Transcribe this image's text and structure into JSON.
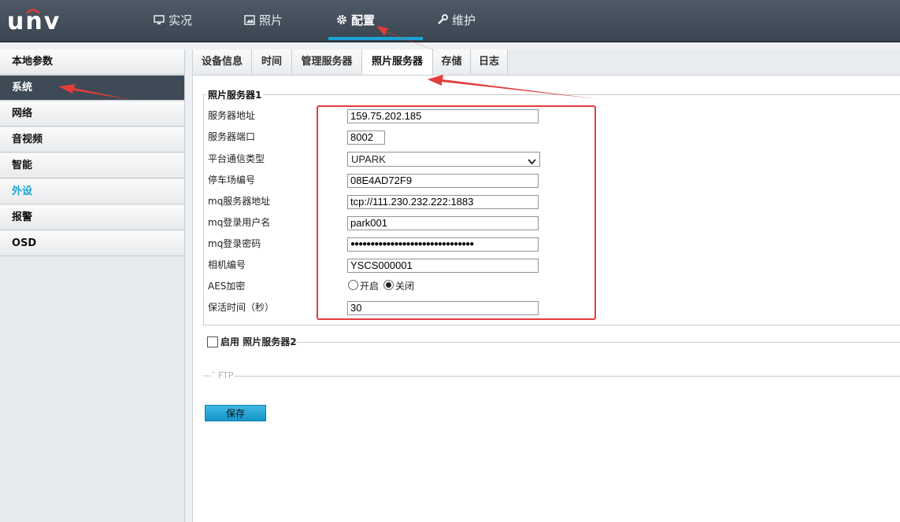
{
  "header": {
    "logo": "UNV",
    "nav": [
      {
        "label": "实况",
        "icon": "monitor-icon"
      },
      {
        "label": "照片",
        "icon": "image-icon"
      },
      {
        "label": "配置",
        "icon": "gear-icon",
        "active": true
      },
      {
        "label": "维护",
        "icon": "wrench-icon"
      }
    ]
  },
  "sidebar": {
    "items": [
      {
        "label": "本地参数"
      },
      {
        "label": "系统",
        "active": true
      },
      {
        "label": "网络"
      },
      {
        "label": "音视频"
      },
      {
        "label": "智能"
      },
      {
        "label": "外设"
      },
      {
        "label": "报警"
      },
      {
        "label": "OSD"
      }
    ]
  },
  "tabs": [
    {
      "label": "设备信息"
    },
    {
      "label": "时间"
    },
    {
      "label": "管理服务器"
    },
    {
      "label": "照片服务器",
      "active": true
    },
    {
      "label": "存储"
    },
    {
      "label": "日志"
    }
  ],
  "server1": {
    "legend": "照片服务器1",
    "fields": {
      "address": {
        "label": "服务器地址",
        "value": "159.75.202.185"
      },
      "port": {
        "label": "服务器端口",
        "value": "8002"
      },
      "platform": {
        "label": "平台通信类型",
        "value": "UPARK"
      },
      "lot": {
        "label": "停车场编号",
        "value": "08E4AD72F9"
      },
      "mq_addr": {
        "label": "mq服务器地址",
        "value": "tcp://111.230.232.222:1883"
      },
      "mq_user": {
        "label": "mq登录用户名",
        "value": "park001"
      },
      "mq_pass": {
        "label": "mq登录密码",
        "value": "●●●●●●●●●●●●●●●●●●●●●●●●●●●●●●●"
      },
      "camera": {
        "label": "相机编号",
        "value": "YSCS000001"
      },
      "aes": {
        "label": "AES加密",
        "on_label": "开启",
        "off_label": "关闭",
        "selected": "off"
      },
      "keepalive": {
        "label": "保活时间（秒）",
        "value": "30"
      }
    }
  },
  "server2": {
    "enable_label": "启用",
    "legend": "照片服务器2",
    "enabled": false
  },
  "ftp": {
    "label": "FTP"
  },
  "save_label": "保存",
  "colors": {
    "accent": "#1aa3d6",
    "annotation": "#e43c3c",
    "header": "#434f5a"
  }
}
